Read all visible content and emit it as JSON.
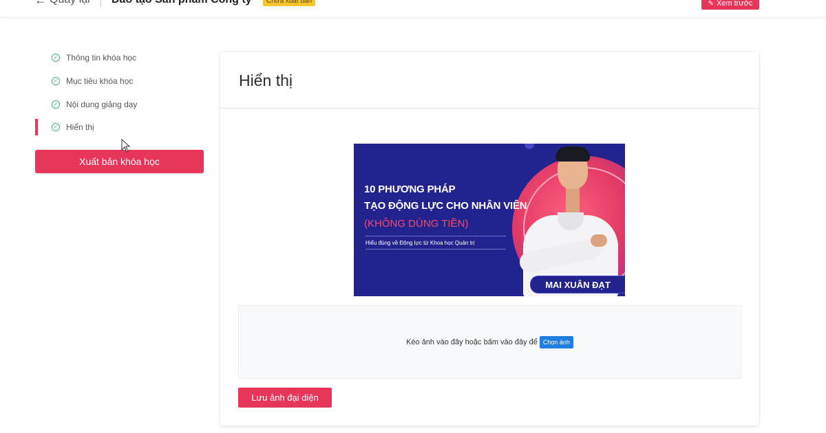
{
  "header": {
    "back_label": "Quay lại",
    "course_title": "Đào tạo Sản phẩm Công ty",
    "status_badge": "Chưa xuất bản",
    "preview_label": "Xem trước"
  },
  "sidebar": {
    "steps": [
      {
        "label": "Thông tin khóa học"
      },
      {
        "label": "Mục tiêu khóa học"
      },
      {
        "label": "Nội dung giảng dạy"
      },
      {
        "label": "Hiển thị"
      }
    ],
    "active_step": "Hiển thị",
    "publish_label": "Xuất bản khóa học"
  },
  "main": {
    "title": "Hiển thị",
    "banner": {
      "line1": "10 PHƯƠNG PHÁP",
      "line2": "TẠO ĐỘNG LỰC CHO NHÂN VIÊN",
      "line3": "(KHÔNG DÙNG TIỀN)",
      "subline": "Hiểu đúng về Động lực từ Khoa học Quản trị",
      "speaker": "MAI XUÂN ĐẠT"
    },
    "dropzone": {
      "hint": "Kéo ảnh vào đây hoặc bấm vào đây để",
      "choose_label": "Chọn ảnh"
    },
    "save_label": "Lưu ảnh đại diện"
  },
  "colors": {
    "accent": "#e8365a",
    "badge": "#f7c52b",
    "check": "#4caf74",
    "choose_button": "#1e7fe0",
    "banner_bg": "#23238e"
  }
}
